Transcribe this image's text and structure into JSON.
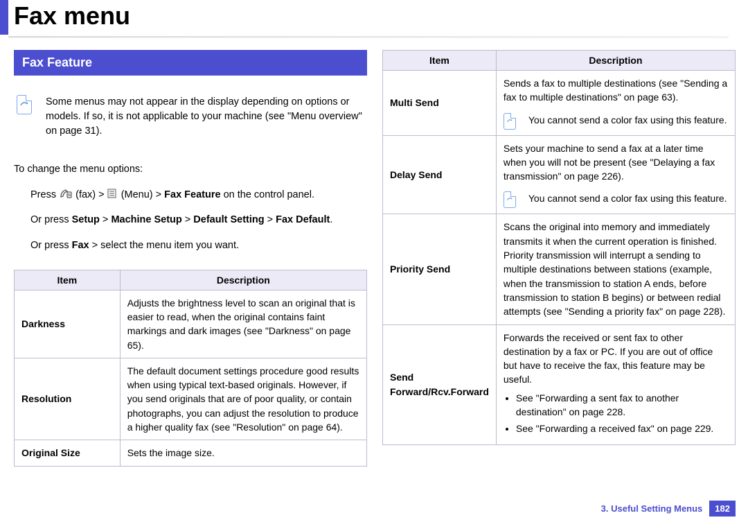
{
  "header": {
    "title": "Fax menu"
  },
  "section": {
    "title": "Fax Feature"
  },
  "note1": "Some menus may not appear in the display depending on options or models. If so, it is not applicable to your machine (see \"Menu overview\" on page 31).",
  "intro": "To change the menu options:",
  "step1": {
    "prefix": "Press ",
    "fax": "(fax) > ",
    "menu_icon_aria": "menu icon",
    "menu": "(Menu) > ",
    "bold": "Fax Feature",
    "suffix": " on the control panel."
  },
  "step2": {
    "prefix": "Or press ",
    "b1": "Setup",
    "s1": " > ",
    "b2": "Machine Setup",
    "s2": " > ",
    "b3": "Default Setting",
    "s3": " > ",
    "b4": "Fax Default",
    "suffix": "."
  },
  "step3": {
    "prefix": "Or press ",
    "b1": "Fax",
    "suffix": " > select the menu item you want."
  },
  "tableL": {
    "headers": [
      "Item",
      "Description"
    ],
    "rows": [
      {
        "item": "Darkness",
        "desc": "Adjusts the brightness level to scan an original that is easier to read, when the original contains faint markings and dark images (see \"Darkness\" on page 65)."
      },
      {
        "item": "Resolution",
        "desc": "The default document settings procedure good results when using typical text-based originals. However, if you send originals that are of poor quality, or contain photographs, you can adjust the resolution to produce a higher quality fax (see \"Resolution\" on page 64)."
      },
      {
        "item": "Original Size",
        "desc": "Sets the image size."
      }
    ]
  },
  "tableR": {
    "headers": [
      "Item",
      "Description"
    ],
    "rows": [
      {
        "item": "Multi Send",
        "desc": "Sends a fax to multiple destinations (see \"Sending a fax to multiple destinations\" on page 63).",
        "note": "You cannot send a color fax using this feature."
      },
      {
        "item": "Delay Send",
        "desc": "Sets your machine to send a fax at a later time when you will not be present (see \"Delaying a fax transmission\" on page 226).",
        "note": "You cannot send a color fax using this feature."
      },
      {
        "item": "Priority Send",
        "desc": "Scans the original into memory and immediately transmits it when the current operation is finished. Priority transmission will interrupt a sending to multiple destinations between stations (example, when the transmission to station A ends, before transmission to station B begins) or between redial attempts (see \"Sending a priority fax\" on page 228)."
      },
      {
        "item": "Send Forward/Rcv.Forward",
        "desc": "Forwards the received or sent fax to other destination by a fax or PC. If you are out of office but have to receive the fax, this feature may be useful.",
        "bullets": [
          "See \"Forwarding a sent fax to another destination\" on page 228.",
          "See \"Forwarding a received fax\" on page 229."
        ]
      }
    ]
  },
  "footer": {
    "chapter": "3.  Useful Setting Menus",
    "page": "182"
  }
}
